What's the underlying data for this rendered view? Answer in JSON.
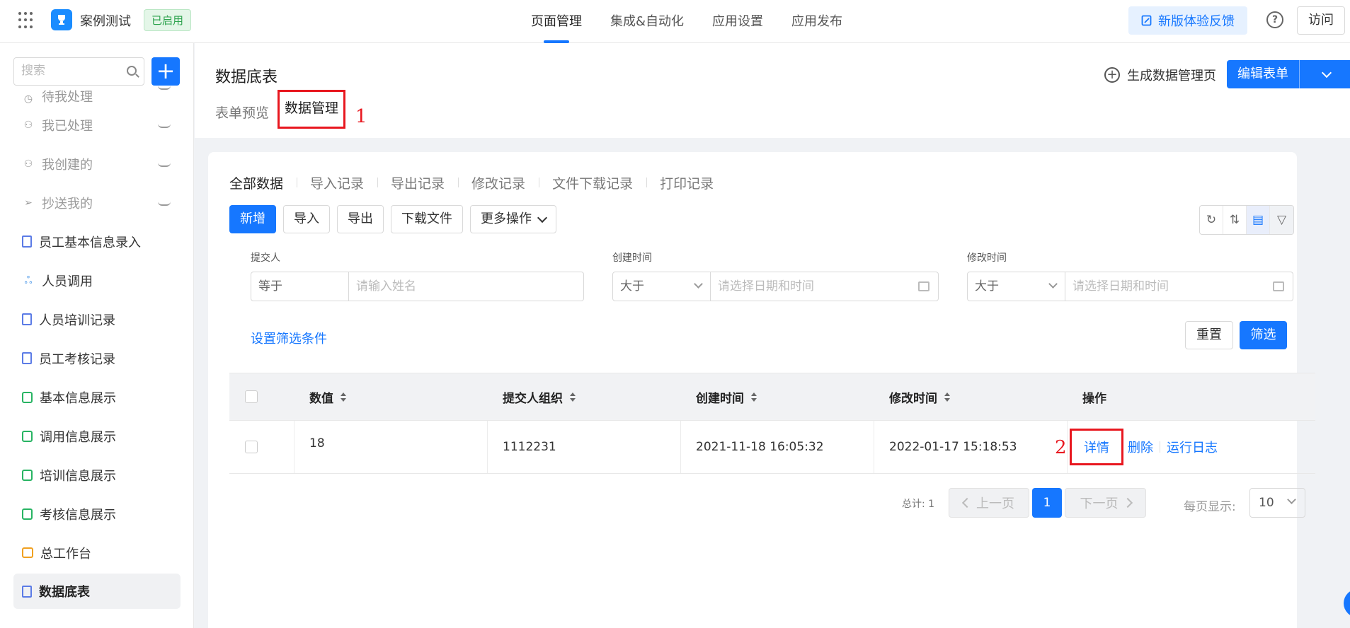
{
  "app": {
    "name": "案例测试",
    "status": "已启用"
  },
  "top_nav": [
    "页面管理",
    "集成&自动化",
    "应用设置",
    "应用发布"
  ],
  "top_right": {
    "feedback": "新版体验反馈",
    "help": "?",
    "visit": "访问"
  },
  "sidebar": {
    "search_placeholder": "搜索",
    "add": "+",
    "items": [
      {
        "label": "待我处理"
      },
      {
        "label": "我已处理"
      },
      {
        "label": "我创建的"
      },
      {
        "label": "抄送我的"
      },
      {
        "label": "员工基本信息录入"
      },
      {
        "label": "人员调用"
      },
      {
        "label": "人员培训记录"
      },
      {
        "label": "员工考核记录"
      },
      {
        "label": "基本信息展示"
      },
      {
        "label": "调用信息展示"
      },
      {
        "label": "培训信息展示"
      },
      {
        "label": "考核信息展示"
      },
      {
        "label": "总工作台"
      },
      {
        "label": "数据底表"
      }
    ]
  },
  "page": {
    "title": "数据底表",
    "gen_manage_page": "生成数据管理页",
    "edit_form": "编辑表单",
    "tabs": [
      "表单预览",
      "数据管理"
    ],
    "annotation_1": "1",
    "annotation_2": "2"
  },
  "data_tabs": [
    "全部数据",
    "导入记录",
    "导出记录",
    "修改记录",
    "文件下载记录",
    "打印记录"
  ],
  "toolbar": {
    "add": "新增",
    "import": "导入",
    "export": "导出",
    "download": "下载文件",
    "more": "更多操作"
  },
  "filters": {
    "submitter": {
      "label": "提交人",
      "op": "等于",
      "placeholder": "请输入姓名"
    },
    "created": {
      "label": "创建时间",
      "op": "大于",
      "placeholder": "请选择日期和时间"
    },
    "modified": {
      "label": "修改时间",
      "op": "大于",
      "placeholder": "请选择日期和时间"
    },
    "set_conditions": "设置筛选条件",
    "reset": "重置",
    "apply": "筛选"
  },
  "table": {
    "headers": [
      "数值",
      "提交人组织",
      "创建时间",
      "修改时间",
      "操作"
    ],
    "rows": [
      {
        "value": "18",
        "org": "1112231",
        "created": "2021-11-18 16:05:32",
        "modified": "2022-01-17 15:18:53"
      }
    ],
    "actions": [
      "详情",
      "删除",
      "运行日志"
    ]
  },
  "pagination": {
    "total": "总计: 1",
    "prev": "上一页",
    "current": "1",
    "next": "下一页",
    "per_page_label": "每页显示:",
    "per_page": "10"
  }
}
